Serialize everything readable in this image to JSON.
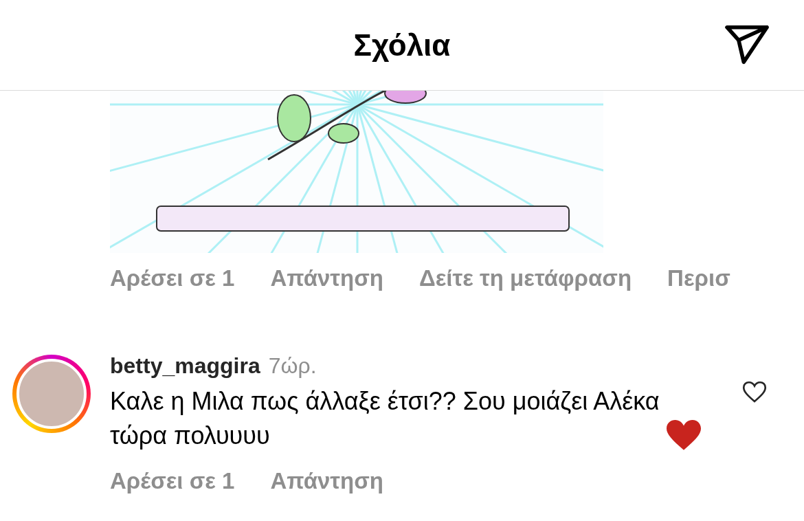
{
  "header": {
    "title": "Σχόλια"
  },
  "comments": [
    {
      "kind": "sticker",
      "actions": [
        "Αρέσει σε 1",
        "Απάντηση",
        "Δείτε τη μετάφραση",
        "Περισ"
      ]
    },
    {
      "kind": "text",
      "username": "betty_maggira",
      "time": "7ώρ.",
      "text": "Καλε η Μιλα πως άλλαξε έτσι?? Σου μοιάζει Αλέκα τώρα πολυυυυ",
      "liked": false,
      "actions": [
        "Αρέσει σε 1",
        "Απάντηση"
      ]
    }
  ]
}
